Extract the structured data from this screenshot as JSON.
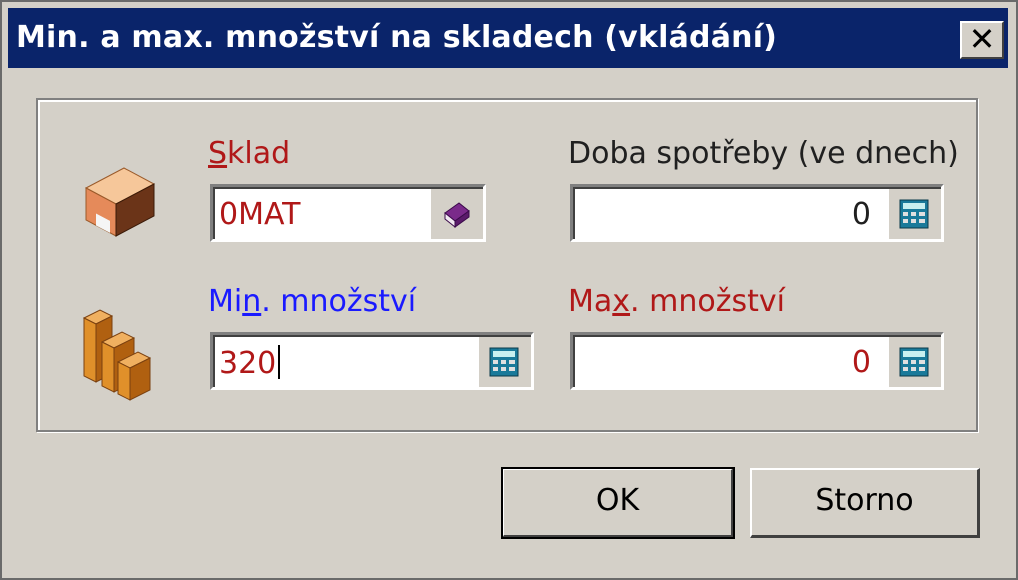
{
  "window": {
    "title": "Min. a max. množství na skladech (vkládání)",
    "close_label": "✕"
  },
  "form": {
    "sklad": {
      "label_first": "S",
      "label_rest": "klad",
      "value": "0MAT"
    },
    "doba": {
      "label": "Doba spotřeby (ve dnech)",
      "value": "0"
    },
    "min": {
      "label_a": "Mi",
      "label_u": "n",
      "label_b": ". množství",
      "value": "320"
    },
    "max": {
      "label_a": "Ma",
      "label_u": "x",
      "label_b": ". množství",
      "value": "0"
    }
  },
  "buttons": {
    "ok": "OK",
    "cancel": "Storno"
  },
  "icons": {
    "warehouse": "warehouse-box-icon",
    "quantity": "stacked-boxes-icon",
    "lookup": "book-icon",
    "calculator": "calculator-icon"
  },
  "colors": {
    "titlebar": "#0a246a",
    "required_label": "#b01818",
    "focus_label": "#1a1aff"
  }
}
